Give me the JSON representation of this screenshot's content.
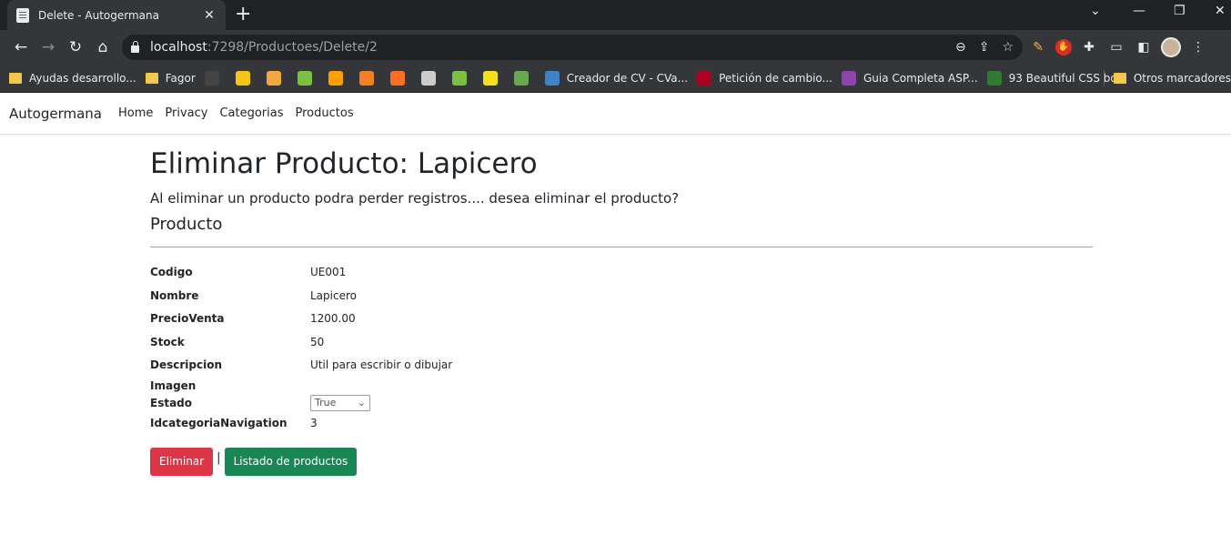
{
  "browser": {
    "tab_title": "Delete - Autogermana",
    "url_host": "localhost",
    "url_rest": ":7298/Productoes/Delete/2",
    "bookmarks": [
      {
        "label": "Ayudas desarrollo...",
        "type": "folder"
      },
      {
        "label": "Fagor",
        "type": "folder"
      },
      {
        "label": "",
        "type": "icon",
        "icon": "github-icon",
        "color": "#444"
      },
      {
        "label": "",
        "type": "icon",
        "icon": "m-icon",
        "color": "#f5c518"
      },
      {
        "label": "",
        "type": "icon",
        "icon": "emoji-icon",
        "color": "#f2a93b"
      },
      {
        "label": "",
        "type": "icon",
        "icon": "diamond-icon",
        "color": "#7ac143"
      },
      {
        "label": "",
        "type": "icon",
        "icon": "firebase-icon",
        "color": "#ffa000"
      },
      {
        "label": "",
        "type": "icon",
        "icon": "stackoverflow-icon",
        "color": "#f48024"
      },
      {
        "label": "",
        "type": "icon",
        "icon": "gitlab-icon",
        "color": "#fc6d26"
      },
      {
        "label": "",
        "type": "icon",
        "icon": "search-icon",
        "color": "#cccccc"
      },
      {
        "label": "",
        "type": "icon",
        "icon": "diamond-icon",
        "color": "#7ac143"
      },
      {
        "label": "",
        "type": "icon",
        "icon": "js-icon",
        "color": "#f7df1e"
      },
      {
        "label": "",
        "type": "icon",
        "icon": "globe-icon",
        "color": "#6aa84f"
      },
      {
        "label": "Creador de CV - CVa...",
        "type": "icon",
        "icon": "cv-icon",
        "color": "#3d85c6"
      },
      {
        "label": "Petición de cambio...",
        "type": "icon",
        "icon": "arc-icon",
        "color": "#b00020"
      },
      {
        "label": "Guia Completa ASP...",
        "type": "icon",
        "icon": "u-icon",
        "color": "#8e44ad"
      },
      {
        "label": "93 Beautiful CSS bo...",
        "type": "icon",
        "icon": "css-icon",
        "color": "#2e7d32"
      }
    ],
    "other_bookmarks": "Otros marcadores"
  },
  "navbar": {
    "brand": "Autogermana",
    "links": [
      "Home",
      "Privacy",
      "Categorias",
      "Productos"
    ]
  },
  "page": {
    "title": "Eliminar Producto: Lapicero",
    "subtitle": "Al eliminar un producto podra perder registros.... desea eliminar el producto?",
    "section": "Producto",
    "fields": [
      {
        "label": "Codigo",
        "value": "UE001"
      },
      {
        "label": "Nombre",
        "value": "Lapicero"
      },
      {
        "label": "PrecioVenta",
        "value": "1200.00"
      },
      {
        "label": "Stock",
        "value": "50"
      },
      {
        "label": "Descripcion",
        "value": "Util para escribir o dibujar"
      },
      {
        "label": "Imagen",
        "value": ""
      },
      {
        "label": "Estado",
        "value": "True"
      },
      {
        "label": "IdcategoriaNavigation",
        "value": "3"
      }
    ],
    "delete_button": "Eliminar",
    "separator": "|",
    "list_button": "Listado de productos"
  }
}
